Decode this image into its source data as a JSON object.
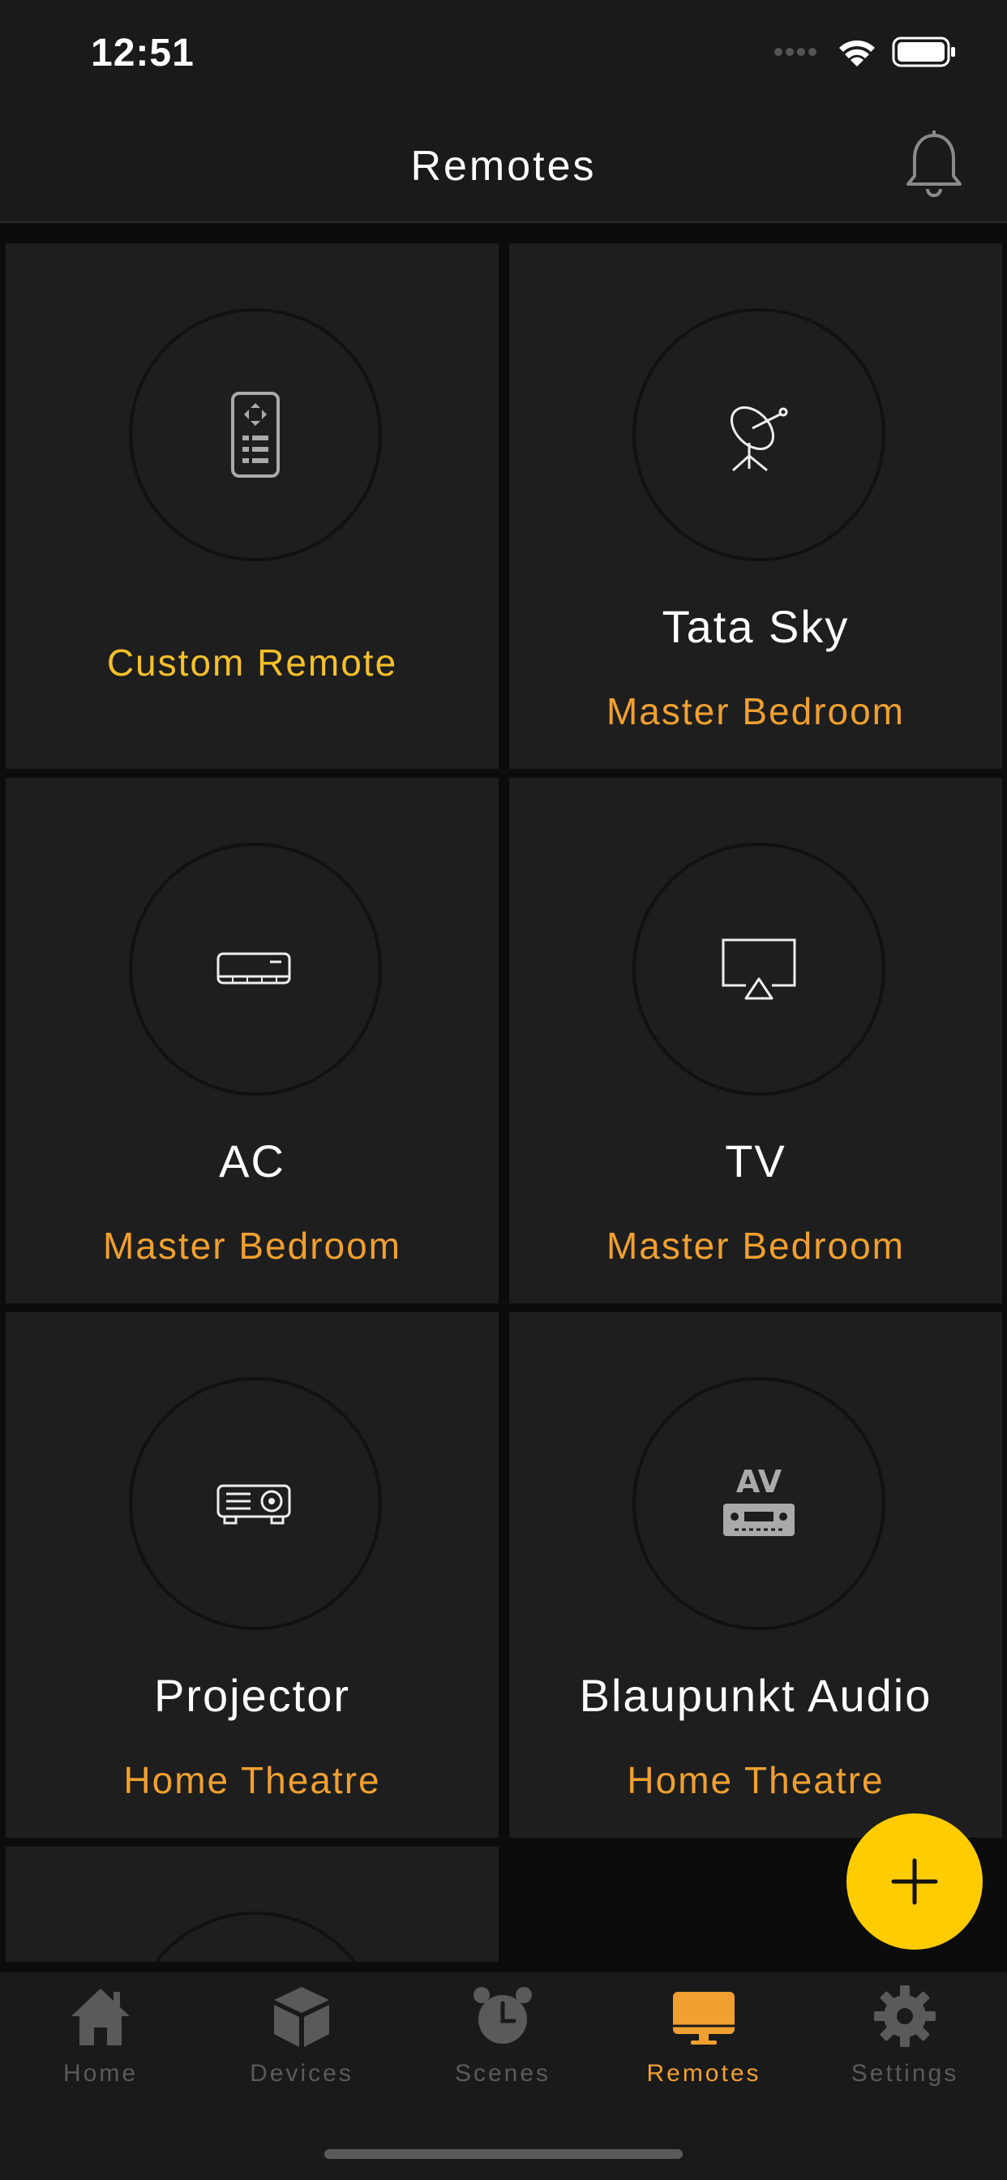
{
  "status": {
    "time": "12:51"
  },
  "header": {
    "title": "Remotes"
  },
  "remotes": [
    {
      "name": "",
      "room": "Custom Remote",
      "icon": "remote-control-icon"
    },
    {
      "name": "Tata Sky",
      "room": "Master Bedroom",
      "icon": "satellite-dish-icon"
    },
    {
      "name": "AC",
      "room": "Master Bedroom",
      "icon": "air-conditioner-icon"
    },
    {
      "name": "TV",
      "room": "Master Bedroom",
      "icon": "tv-airplay-icon"
    },
    {
      "name": "Projector",
      "room": "Home Theatre",
      "icon": "projector-icon"
    },
    {
      "name": "Blaupunkt Audio",
      "room": "Home Theatre",
      "icon": "av-receiver-icon"
    }
  ],
  "fab": {
    "icon": "plus-icon"
  },
  "tabs": [
    {
      "label": "Home",
      "icon": "home-icon",
      "active": false
    },
    {
      "label": "Devices",
      "icon": "cube-icon",
      "active": false
    },
    {
      "label": "Scenes",
      "icon": "alarm-clock-icon",
      "active": false
    },
    {
      "label": "Remotes",
      "icon": "monitor-icon",
      "active": true
    },
    {
      "label": "Settings",
      "icon": "gear-icon",
      "active": false
    }
  ],
  "colors": {
    "accent": "#f0a030",
    "fab": "#ffcc00",
    "background": "#0c0c0c",
    "card": "#1e1e1e"
  }
}
